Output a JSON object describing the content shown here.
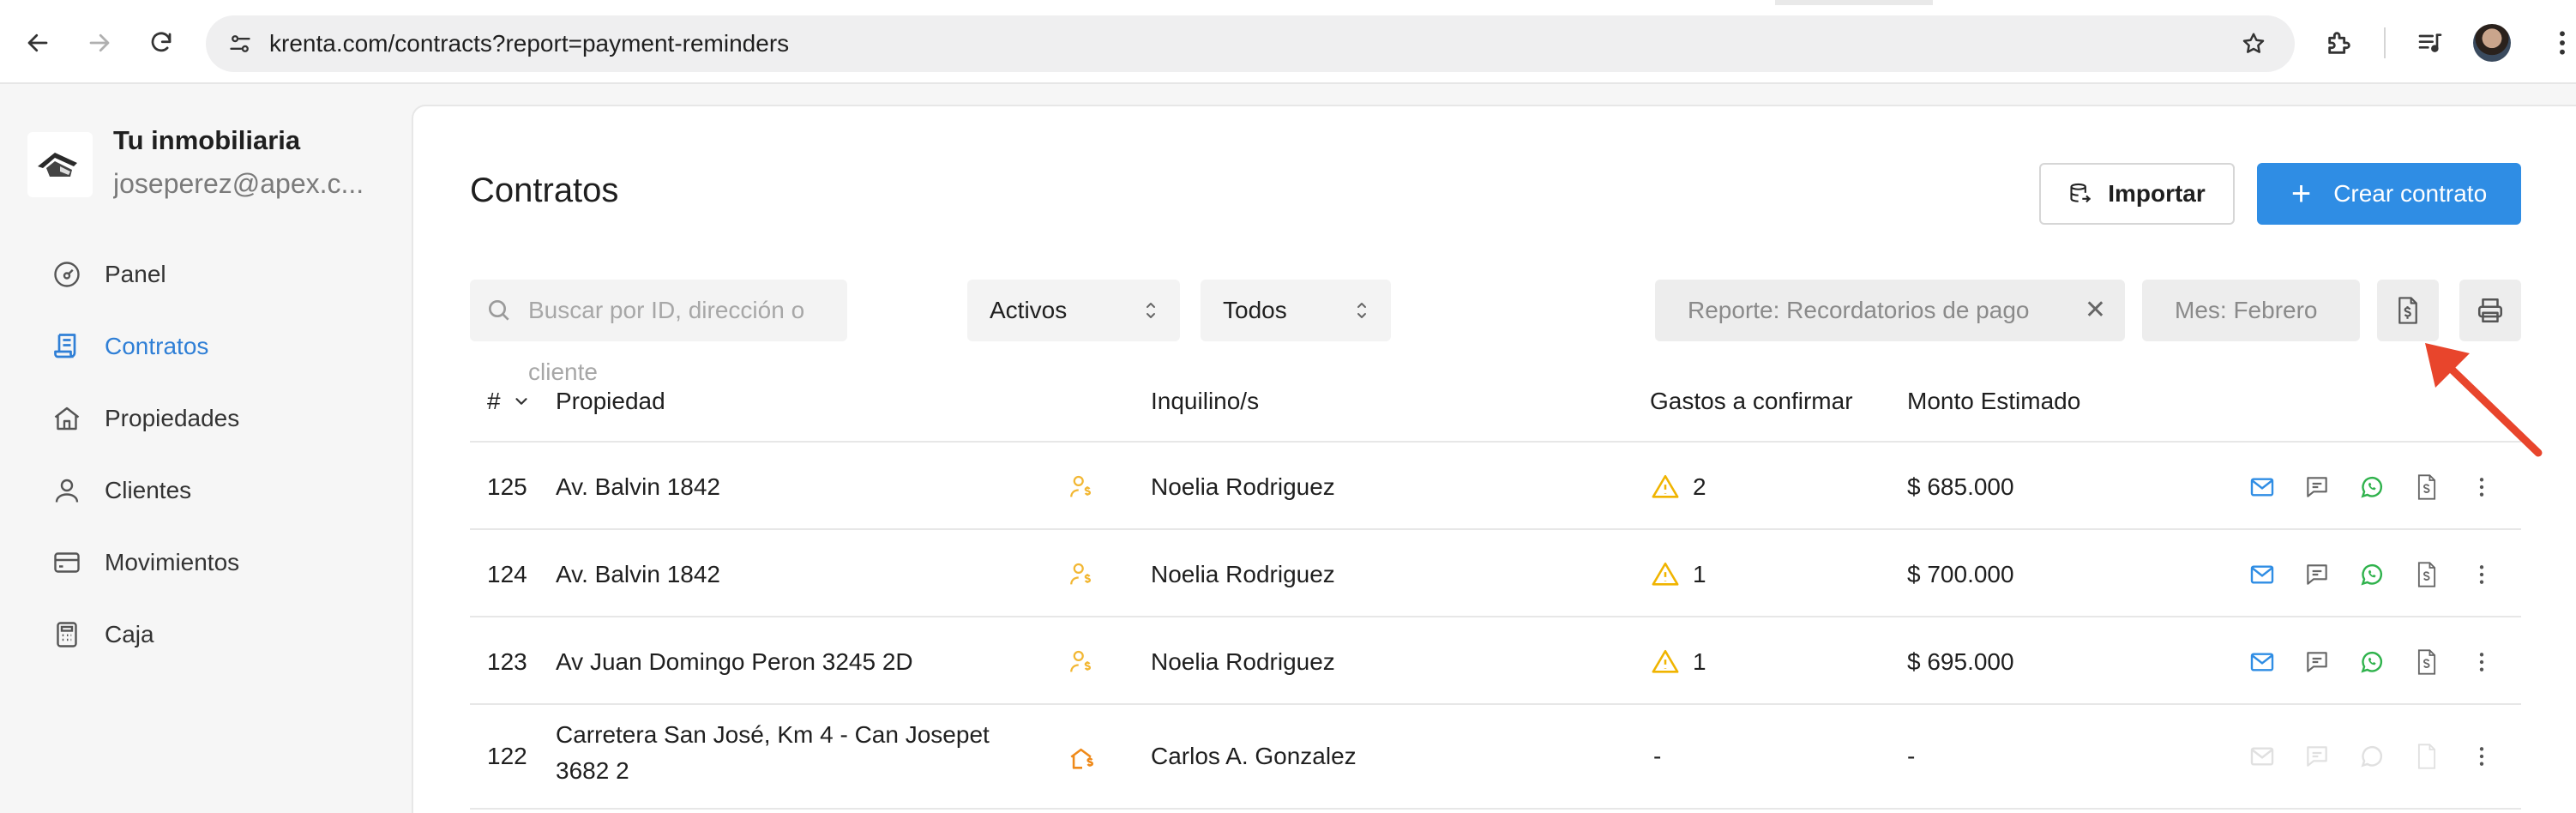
{
  "browser": {
    "url": "krenta.com/contracts?report=payment-reminders"
  },
  "sidebar": {
    "org_name": "Tu inmobiliaria",
    "org_email": "joseperez@apex.c...",
    "items": [
      {
        "label": "Panel",
        "icon": "dashboard-gauge-icon",
        "active": false
      },
      {
        "label": "Contratos",
        "icon": "contract-scroll-icon",
        "active": true
      },
      {
        "label": "Propiedades",
        "icon": "house-icon",
        "active": false
      },
      {
        "label": "Clientes",
        "icon": "user-icon",
        "active": false
      },
      {
        "label": "Movimientos",
        "icon": "credit-card-icon",
        "active": false
      },
      {
        "label": "Caja",
        "icon": "calculator-icon",
        "active": false
      }
    ]
  },
  "main": {
    "title": "Contratos",
    "import_label": "Importar",
    "create_label": "Crear contrato",
    "search_placeholder": "Buscar por ID, dirección o cliente",
    "status_select": "Activos",
    "type_select": "Todos",
    "report_chip": "Reporte: Recordatorios de pago",
    "month_chip": "Mes: Febrero"
  },
  "table": {
    "headers": {
      "id": "#",
      "property": "Propiedad",
      "tenant": "Inquilino/s",
      "expenses": "Gastos a confirmar",
      "amount": "Monto Estimado"
    },
    "rows": [
      {
        "id": "125",
        "property": "Av. Balvin 1842",
        "tenant": "Noelia Rodriguez",
        "expenses": "2",
        "amount": "$ 685.000",
        "owner_icon": "user-dollar-icon",
        "enabled": true
      },
      {
        "id": "124",
        "property": "Av. Balvin 1842",
        "tenant": "Noelia Rodriguez",
        "expenses": "1",
        "amount": "$ 700.000",
        "owner_icon": "user-dollar-icon",
        "enabled": true
      },
      {
        "id": "123",
        "property": "Av Juan Domingo Peron 3245 2D",
        "tenant": "Noelia Rodriguez",
        "expenses": "1",
        "amount": "$ 695.000",
        "owner_icon": "user-dollar-icon",
        "enabled": true
      },
      {
        "id": "122",
        "property": "Carretera San José, Km 4 - Can Josepet 3682 2",
        "tenant": "Carlos A. Gonzalez",
        "expenses": "-",
        "amount": "-",
        "owner_icon": "house-dollar-icon",
        "enabled": false
      }
    ]
  },
  "colors": {
    "accent": "#2f8de4",
    "active_nav": "#2f7fd6",
    "warning": "#f0b400",
    "owner_icon": "#f2b733",
    "whatsapp": "#2fb24c",
    "arrow": "#e8452c"
  }
}
